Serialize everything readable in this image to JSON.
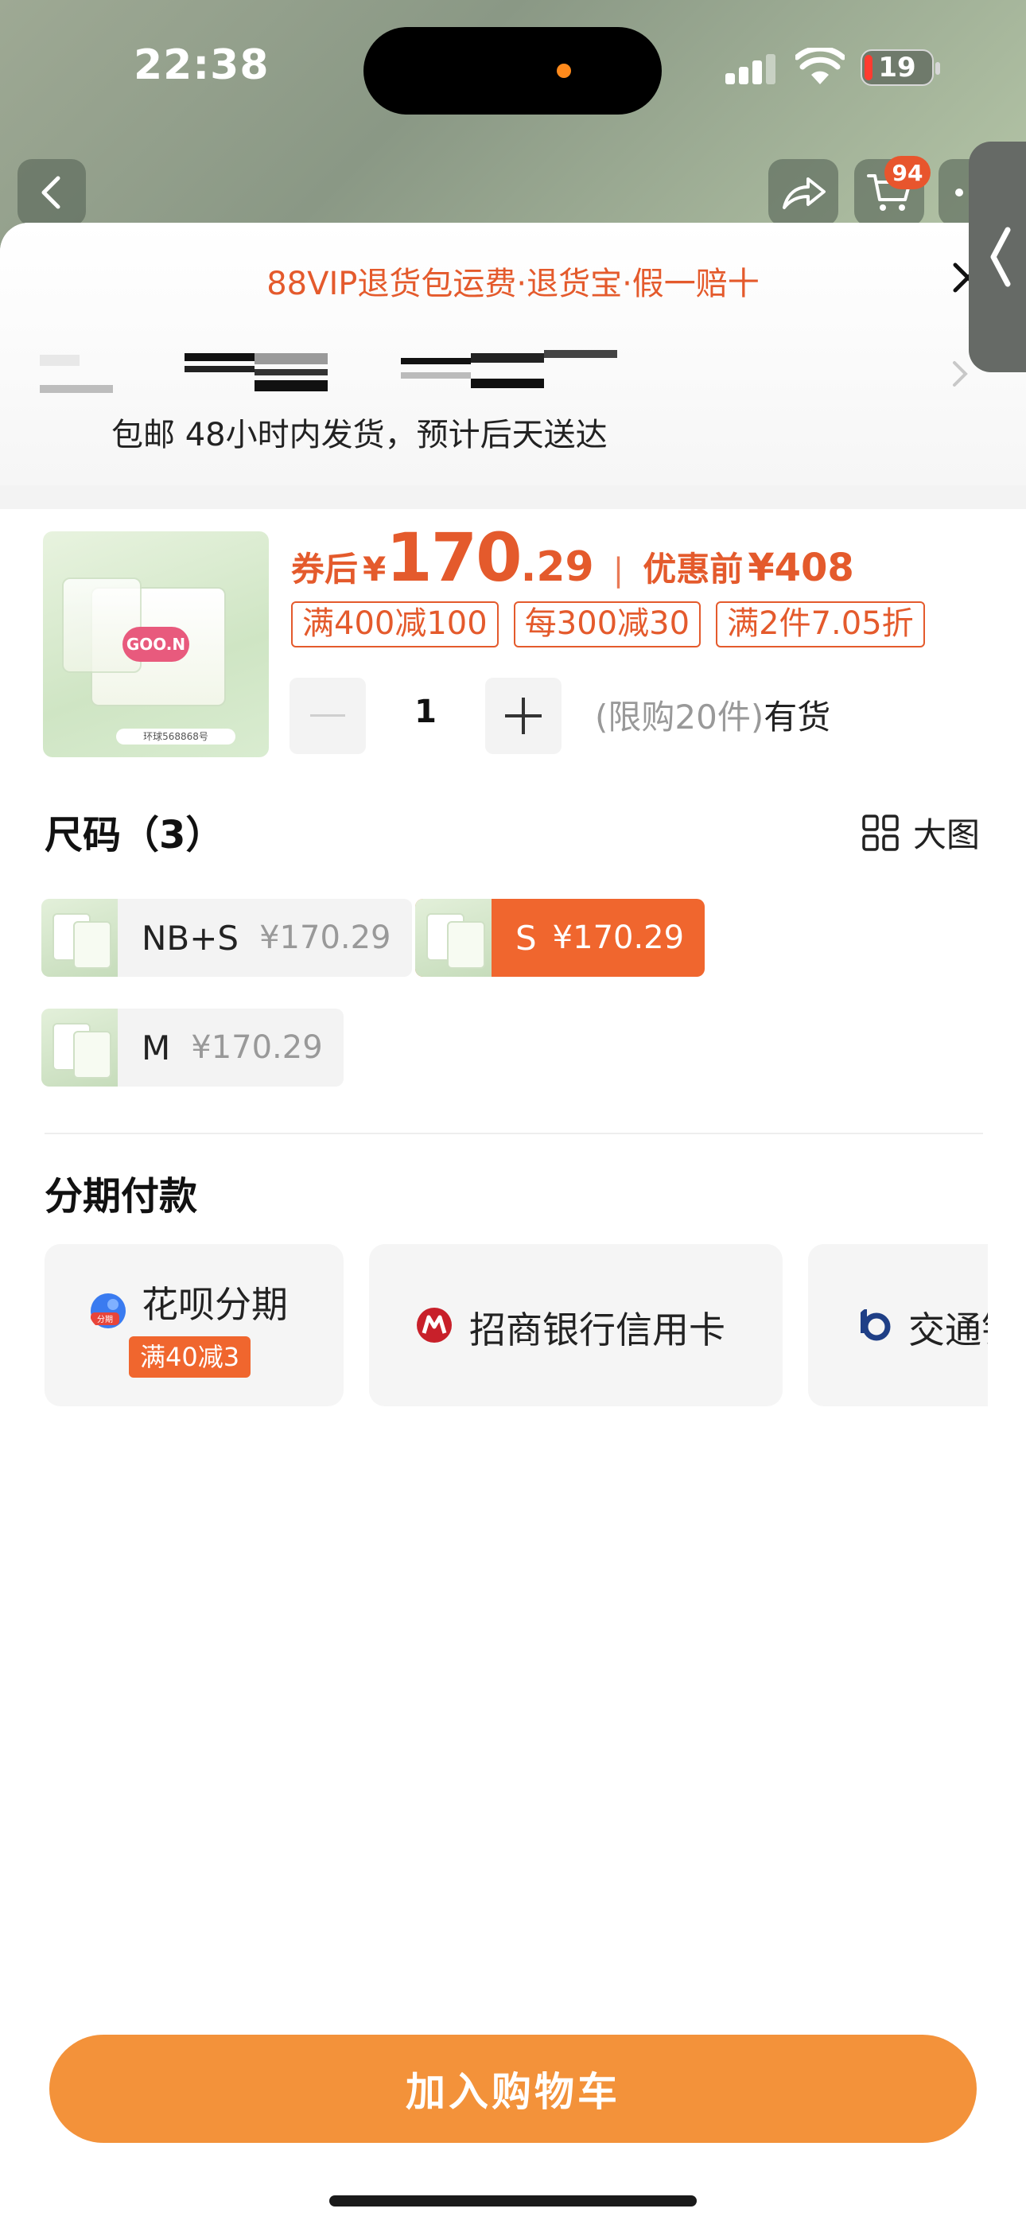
{
  "status_bar": {
    "time": "22:38",
    "battery": "19"
  },
  "nav": {
    "cart_badge": "94"
  },
  "sheet": {
    "vip_banner": "88VIP退货包运费·退货宝·假一赔十",
    "shipping": "包邮 48小时内发货，预计后天送达"
  },
  "product": {
    "price": {
      "label": "券后",
      "currency": "¥",
      "integer": "170",
      "decimal": ".29",
      "separator": "|",
      "before_label": "优惠前",
      "before_value": "¥408"
    },
    "promos": [
      "满400减100",
      "每300减30",
      "满2件7.05折"
    ],
    "quantity": "1",
    "limit_text": "(限购20件)",
    "stock_text": "有货",
    "image_tag": "环球568868号"
  },
  "size": {
    "title": "尺码（3）",
    "big_image_label": "大图",
    "options": [
      {
        "name": "NB+S",
        "price": "¥170.29",
        "selected": false
      },
      {
        "name": "S",
        "price": "¥170.29",
        "selected": true
      },
      {
        "name": "M",
        "price": "¥170.29",
        "selected": false
      }
    ]
  },
  "installment": {
    "title": "分期付款",
    "options": [
      {
        "label": "花呗分期",
        "tag": "满40减3",
        "icon": "huabei-icon",
        "icon_text": "分期"
      },
      {
        "label": "招商银行信用卡",
        "icon": "cmb-bank-icon"
      },
      {
        "label": "交通银行",
        "icon": "bocom-bank-icon"
      }
    ]
  },
  "actions": {
    "add_to_cart": "加入购物车"
  },
  "colors": {
    "accent": "#e45a2c",
    "selected_chip": "#f0662e",
    "cart_button": "#f3923a"
  }
}
